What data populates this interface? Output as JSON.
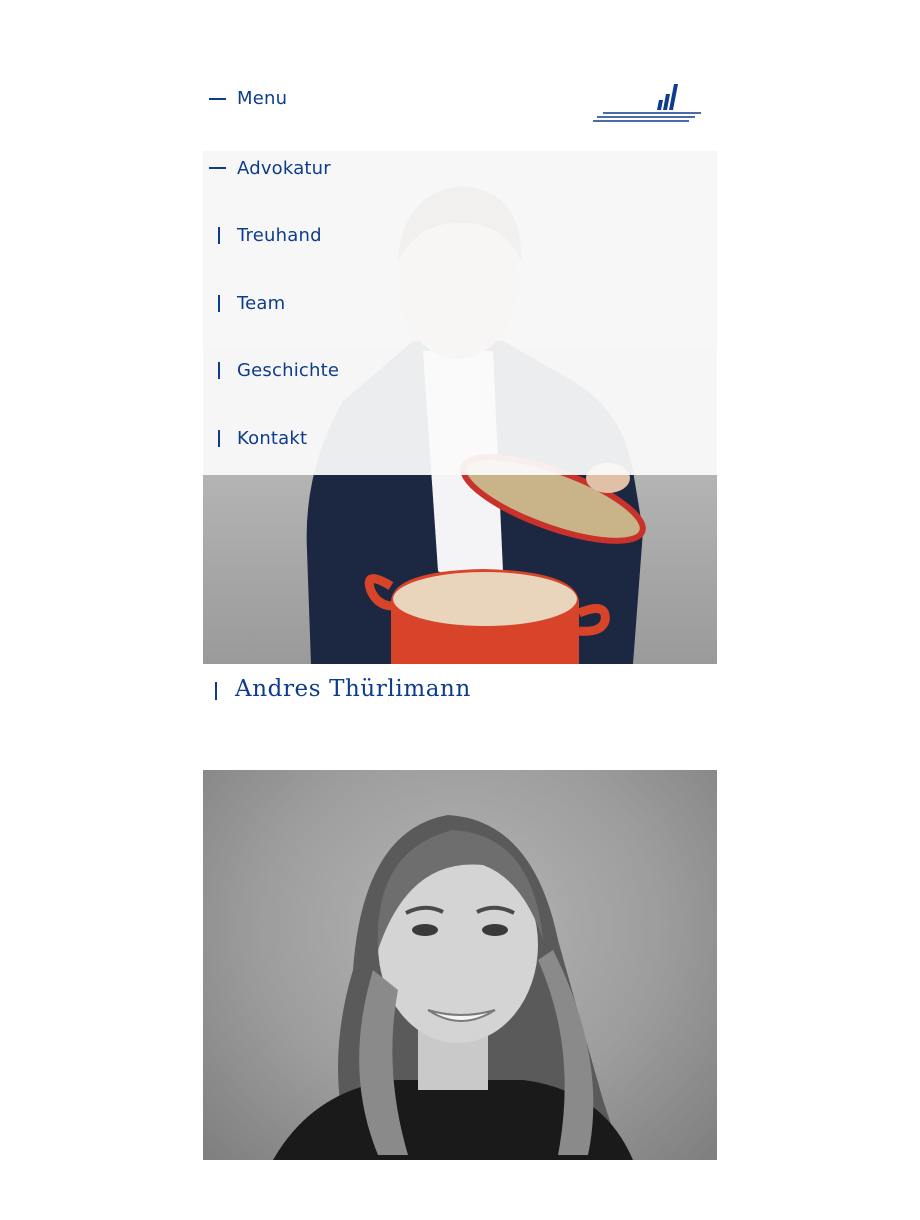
{
  "header": {
    "menu_label": "Menu",
    "logo_icon": "company-logo-icon"
  },
  "nav": {
    "items": [
      {
        "label": "Advokatur",
        "marker": "dash",
        "active": true
      },
      {
        "label": "Treuhand",
        "marker": "bar"
      },
      {
        "label": "Team",
        "marker": "bar"
      },
      {
        "label": "Geschichte",
        "marker": "bar"
      },
      {
        "label": "Kontakt",
        "marker": "bar"
      }
    ]
  },
  "team": {
    "members": [
      {
        "name": "Andres Thürlimann"
      }
    ]
  },
  "colors": {
    "brand_blue": "#0e3c8c",
    "pot_red": "#d8442a",
    "overlay": "#fafafa"
  }
}
